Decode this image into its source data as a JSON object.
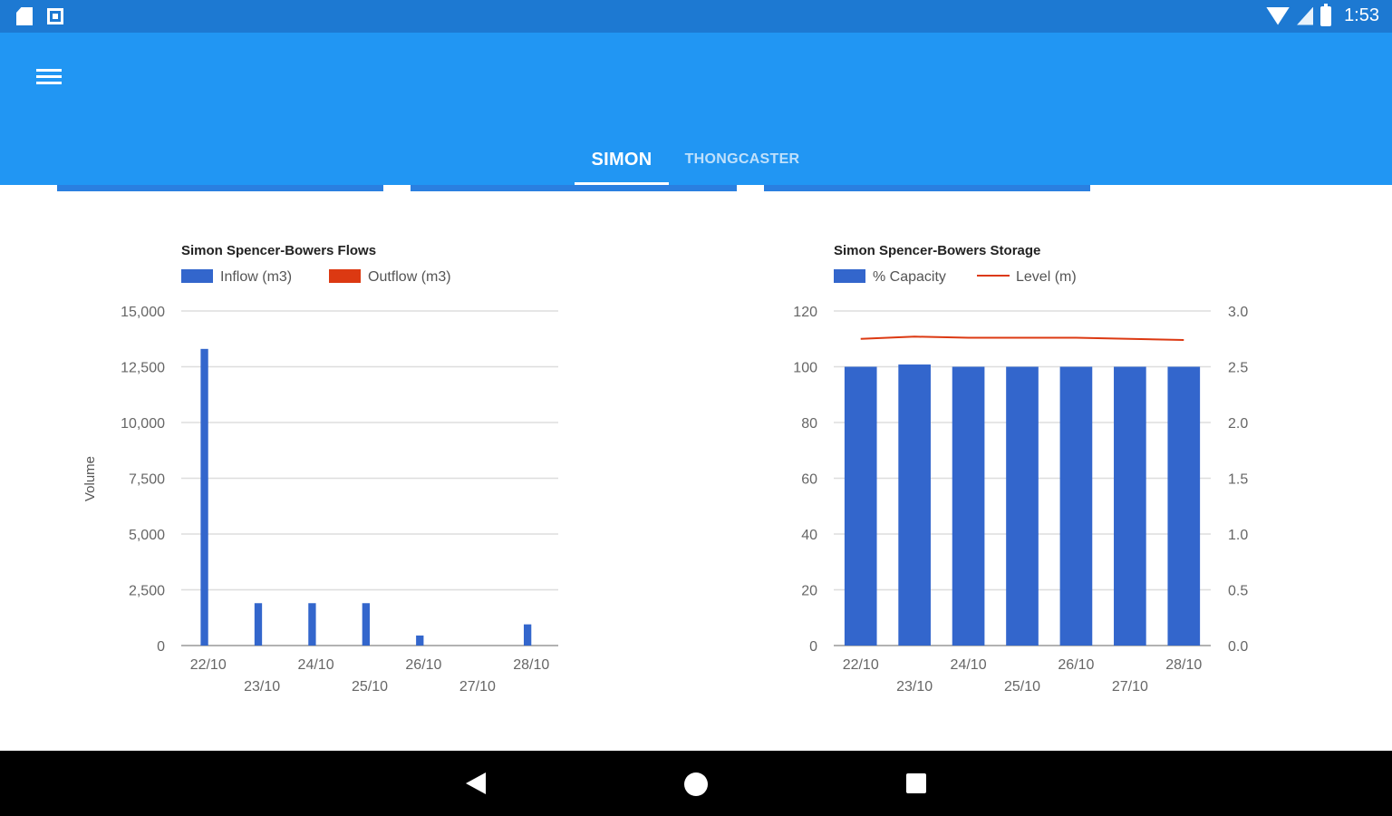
{
  "status_bar": {
    "time": "1:53",
    "left_icons": [
      "sd-card-icon",
      "photo-icon"
    ],
    "right_icons": [
      "wifi-icon",
      "signal-icon",
      "battery-icon"
    ]
  },
  "app_bar": {
    "menu_icon": "menu-icon",
    "tabs": [
      {
        "label": "SIMON",
        "selected": true
      },
      {
        "label": "THONGCASTER",
        "selected": false
      }
    ],
    "color": "#2196f3",
    "status_color": "#1d79d2"
  },
  "nav_bar": {
    "icons": [
      "back-icon",
      "home-icon",
      "recents-icon"
    ]
  },
  "chart_data": [
    {
      "type": "bar",
      "title": "Simon Spencer-Bowers Flows",
      "legend": [
        "Inflow (m3)",
        "Outflow (m3)"
      ],
      "legend_colors": [
        "#3366cc",
        "#dc3912"
      ],
      "ylabel": "Volume",
      "ylim": [
        0,
        15000
      ],
      "yticks": [
        "15,000",
        "12,500",
        "10,000",
        "7,500",
        "5,000",
        "2,500",
        "0"
      ],
      "categories": [
        "22/10",
        "23/10",
        "24/10",
        "25/10",
        "26/10",
        "27/10",
        "28/10"
      ],
      "series": [
        {
          "name": "Inflow (m3)",
          "color": "#3366cc",
          "values": [
            13300,
            1900,
            1900,
            1900,
            450,
            0,
            950
          ]
        },
        {
          "name": "Outflow (m3)",
          "color": "#dc3912",
          "values": [
            0,
            0,
            0,
            0,
            0,
            0,
            0
          ]
        }
      ],
      "grid": true,
      "legend_position": "top"
    },
    {
      "type": "bar",
      "title": "Simon Spencer-Bowers Storage",
      "legend": [
        "% Capacity",
        "Level (m)"
      ],
      "legend_colors": [
        "#3366cc",
        "#dc3912"
      ],
      "ylim": [
        0,
        120
      ],
      "yticks": [
        "120",
        "100",
        "80",
        "60",
        "40",
        "20",
        "0"
      ],
      "y2lim": [
        0,
        3.0
      ],
      "y2ticks": [
        "3.0",
        "2.5",
        "2.0",
        "1.5",
        "1.0",
        "0.5",
        "0.0"
      ],
      "categories": [
        "22/10",
        "23/10",
        "24/10",
        "25/10",
        "26/10",
        "27/10",
        "28/10"
      ],
      "series": [
        {
          "name": "% Capacity",
          "type": "bar",
          "color": "#3366cc",
          "values": [
            100,
            100.8,
            100,
            100,
            100,
            100,
            100
          ]
        },
        {
          "name": "Level (m)",
          "type": "line",
          "color": "#dc3912",
          "axis": "right",
          "values": [
            2.75,
            2.77,
            2.76,
            2.76,
            2.76,
            2.75,
            2.74
          ]
        }
      ],
      "grid": true,
      "legend_position": "top"
    }
  ]
}
